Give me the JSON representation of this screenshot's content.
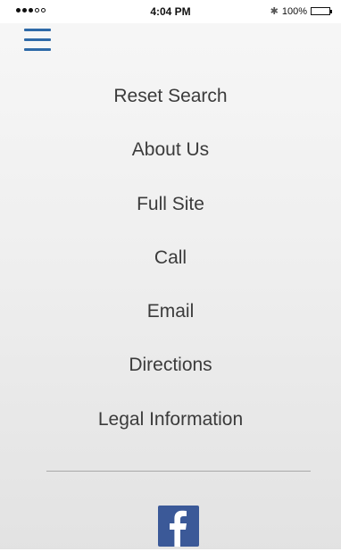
{
  "status_bar": {
    "time": "4:04 PM",
    "battery_percent": "100%",
    "battery_level": 1.0,
    "signal_bars_filled": 3,
    "signal_bars_total": 5
  },
  "menu": {
    "items": [
      {
        "label": "Reset Search"
      },
      {
        "label": "About Us"
      },
      {
        "label": "Full Site"
      },
      {
        "label": "Call"
      },
      {
        "label": "Email"
      },
      {
        "label": "Directions"
      },
      {
        "label": "Legal Information"
      }
    ]
  },
  "colors": {
    "accent": "#2f6aa8",
    "facebook": "#3b5998",
    "text": "#3b3b3b"
  },
  "icons": {
    "menu": "hamburger-icon",
    "social": "facebook-icon"
  }
}
